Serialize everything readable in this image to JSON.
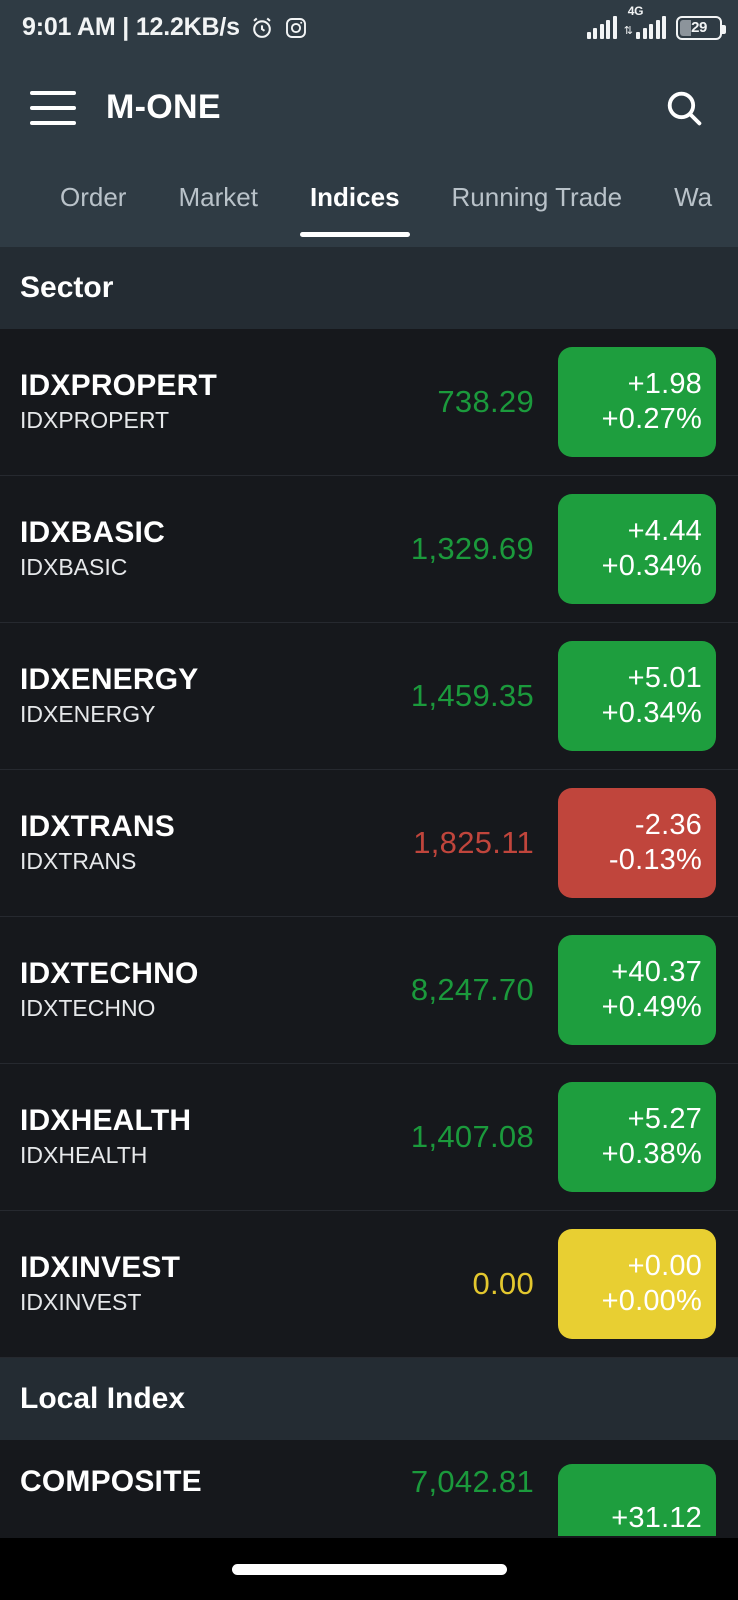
{
  "status_bar": {
    "time_and_speed": "9:01 AM | 12.2KB/s",
    "alarm_icon": "alarm-clock-icon",
    "instagram_icon": "instagram-icon",
    "network_type": "4G",
    "battery_percent": "29",
    "signal_icon": "signal-bars-icon"
  },
  "app_bar": {
    "menu_icon": "hamburger-menu-icon",
    "title": "M-ONE",
    "search_icon": "search-icon"
  },
  "tabs": {
    "items": [
      {
        "label": "Order",
        "active": false
      },
      {
        "label": "Market",
        "active": false
      },
      {
        "label": "Indices",
        "active": true
      },
      {
        "label": "Running Trade",
        "active": false
      },
      {
        "label": "Wa",
        "active": false
      }
    ]
  },
  "sections": [
    {
      "title": "Sector",
      "rows": [
        {
          "code": "IDXPROPERT",
          "name": "IDXPROPERT",
          "value": "738.29",
          "change": "+1.98",
          "percent": "+0.27%",
          "direction": "up"
        },
        {
          "code": "IDXBASIC",
          "name": "IDXBASIC",
          "value": "1,329.69",
          "change": "+4.44",
          "percent": "+0.34%",
          "direction": "up"
        },
        {
          "code": "IDXENERGY",
          "name": "IDXENERGY",
          "value": "1,459.35",
          "change": "+5.01",
          "percent": "+0.34%",
          "direction": "up"
        },
        {
          "code": "IDXTRANS",
          "name": "IDXTRANS",
          "value": "1,825.11",
          "change": "-2.36",
          "percent": "-0.13%",
          "direction": "down"
        },
        {
          "code": "IDXTECHNO",
          "name": "IDXTECHNO",
          "value": "8,247.70",
          "change": "+40.37",
          "percent": "+0.49%",
          "direction": "up"
        },
        {
          "code": "IDXHEALTH",
          "name": "IDXHEALTH",
          "value": "1,407.08",
          "change": "+5.27",
          "percent": "+0.38%",
          "direction": "up"
        },
        {
          "code": "IDXINVEST",
          "name": "IDXINVEST",
          "value": "0.00",
          "change": "+0.00",
          "percent": "+0.00%",
          "direction": "flat"
        }
      ]
    },
    {
      "title": "Local Index",
      "rows": [
        {
          "code": "COMPOSITE",
          "name": "",
          "value": "7,042.81",
          "change": "+31.12",
          "percent": "",
          "direction": "up"
        }
      ]
    }
  ],
  "colors": {
    "up": "#1e9e3e",
    "down": "#c0453c",
    "flat": "#e8cf32",
    "appbar": "#2f3b44",
    "section_header": "#242c33",
    "row_background": "#16181c"
  }
}
